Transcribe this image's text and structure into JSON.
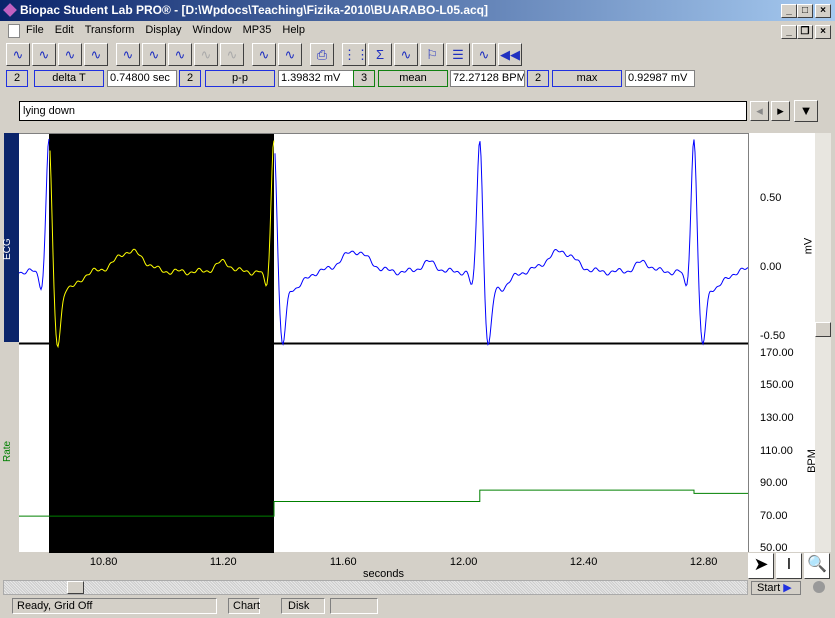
{
  "window": {
    "title": "Biopac Student Lab PRO® - [D:\\Wpdocs\\Teaching\\Fizika-2010\\BUARABO-L05.acq]"
  },
  "menu": [
    "File",
    "Edit",
    "Transform",
    "Display",
    "Window",
    "MP35",
    "Help"
  ],
  "toolbar": [
    "overlap-icon",
    "split-icon",
    "find-icon",
    "ecg-icon",
    "autoscale-icon",
    "adjust-icon",
    "waveform-icon",
    "disabled-1-icon",
    "disabled-2-icon",
    "peak-icon",
    "peak2-icon",
    "print-icon",
    "grid-icon",
    "sigma-icon",
    "measure-icon",
    "marker-icon",
    "journal-icon",
    "chart-icon",
    "rewind-icon"
  ],
  "measurements": [
    {
      "channel": "2",
      "label": "delta T",
      "value": "0.74800 sec",
      "color": "#2030e0"
    },
    {
      "channel": "2",
      "label": "p-p",
      "value": "1.39832 mV",
      "color": "#2030e0"
    },
    {
      "channel": "3",
      "label": "mean",
      "value": "72.27128 BPM",
      "color": "#108010"
    },
    {
      "channel": "2",
      "label": "max",
      "value": "0.92987 mV",
      "color": "#2030e0"
    }
  ],
  "journal": {
    "value": "lying down"
  },
  "chart_data": [
    {
      "type": "line",
      "channel": "ECG",
      "ylabel": "mV",
      "yticks": [
        "0.50",
        "0.00",
        "-0.50"
      ],
      "ylim": [
        -0.54,
        0.985
      ],
      "color": "#0000ff",
      "selection_color": "#ffff00",
      "r_peaks_s": [
        10.617,
        11.367,
        12.053,
        12.767
      ]
    },
    {
      "type": "line",
      "channel": "Rate",
      "ylabel": "BPM",
      "yticks": [
        "170.00",
        "150.00",
        "130.00",
        "110.00",
        "90.00",
        "70.00",
        "50.00"
      ],
      "ylim": [
        48.4,
        176
      ],
      "color": "#008000",
      "steps": [
        {
          "from": 10.517,
          "value": 71
        },
        {
          "from": 11.367,
          "value": 80
        },
        {
          "from": 12.053,
          "value": 87
        },
        {
          "from": 12.767,
          "value": 85
        }
      ]
    }
  ],
  "xaxis": {
    "label": "seconds",
    "ticks": [
      "10.80",
      "11.20",
      "11.60",
      "12.00",
      "12.40",
      "12.80"
    ],
    "range": [
      10.517,
      12.947
    ],
    "selection": [
      10.617,
      11.367
    ]
  },
  "start_label": "Start",
  "status": {
    "text": "Ready, Grid Off",
    "chart": "Chart",
    "disk": "Disk"
  }
}
